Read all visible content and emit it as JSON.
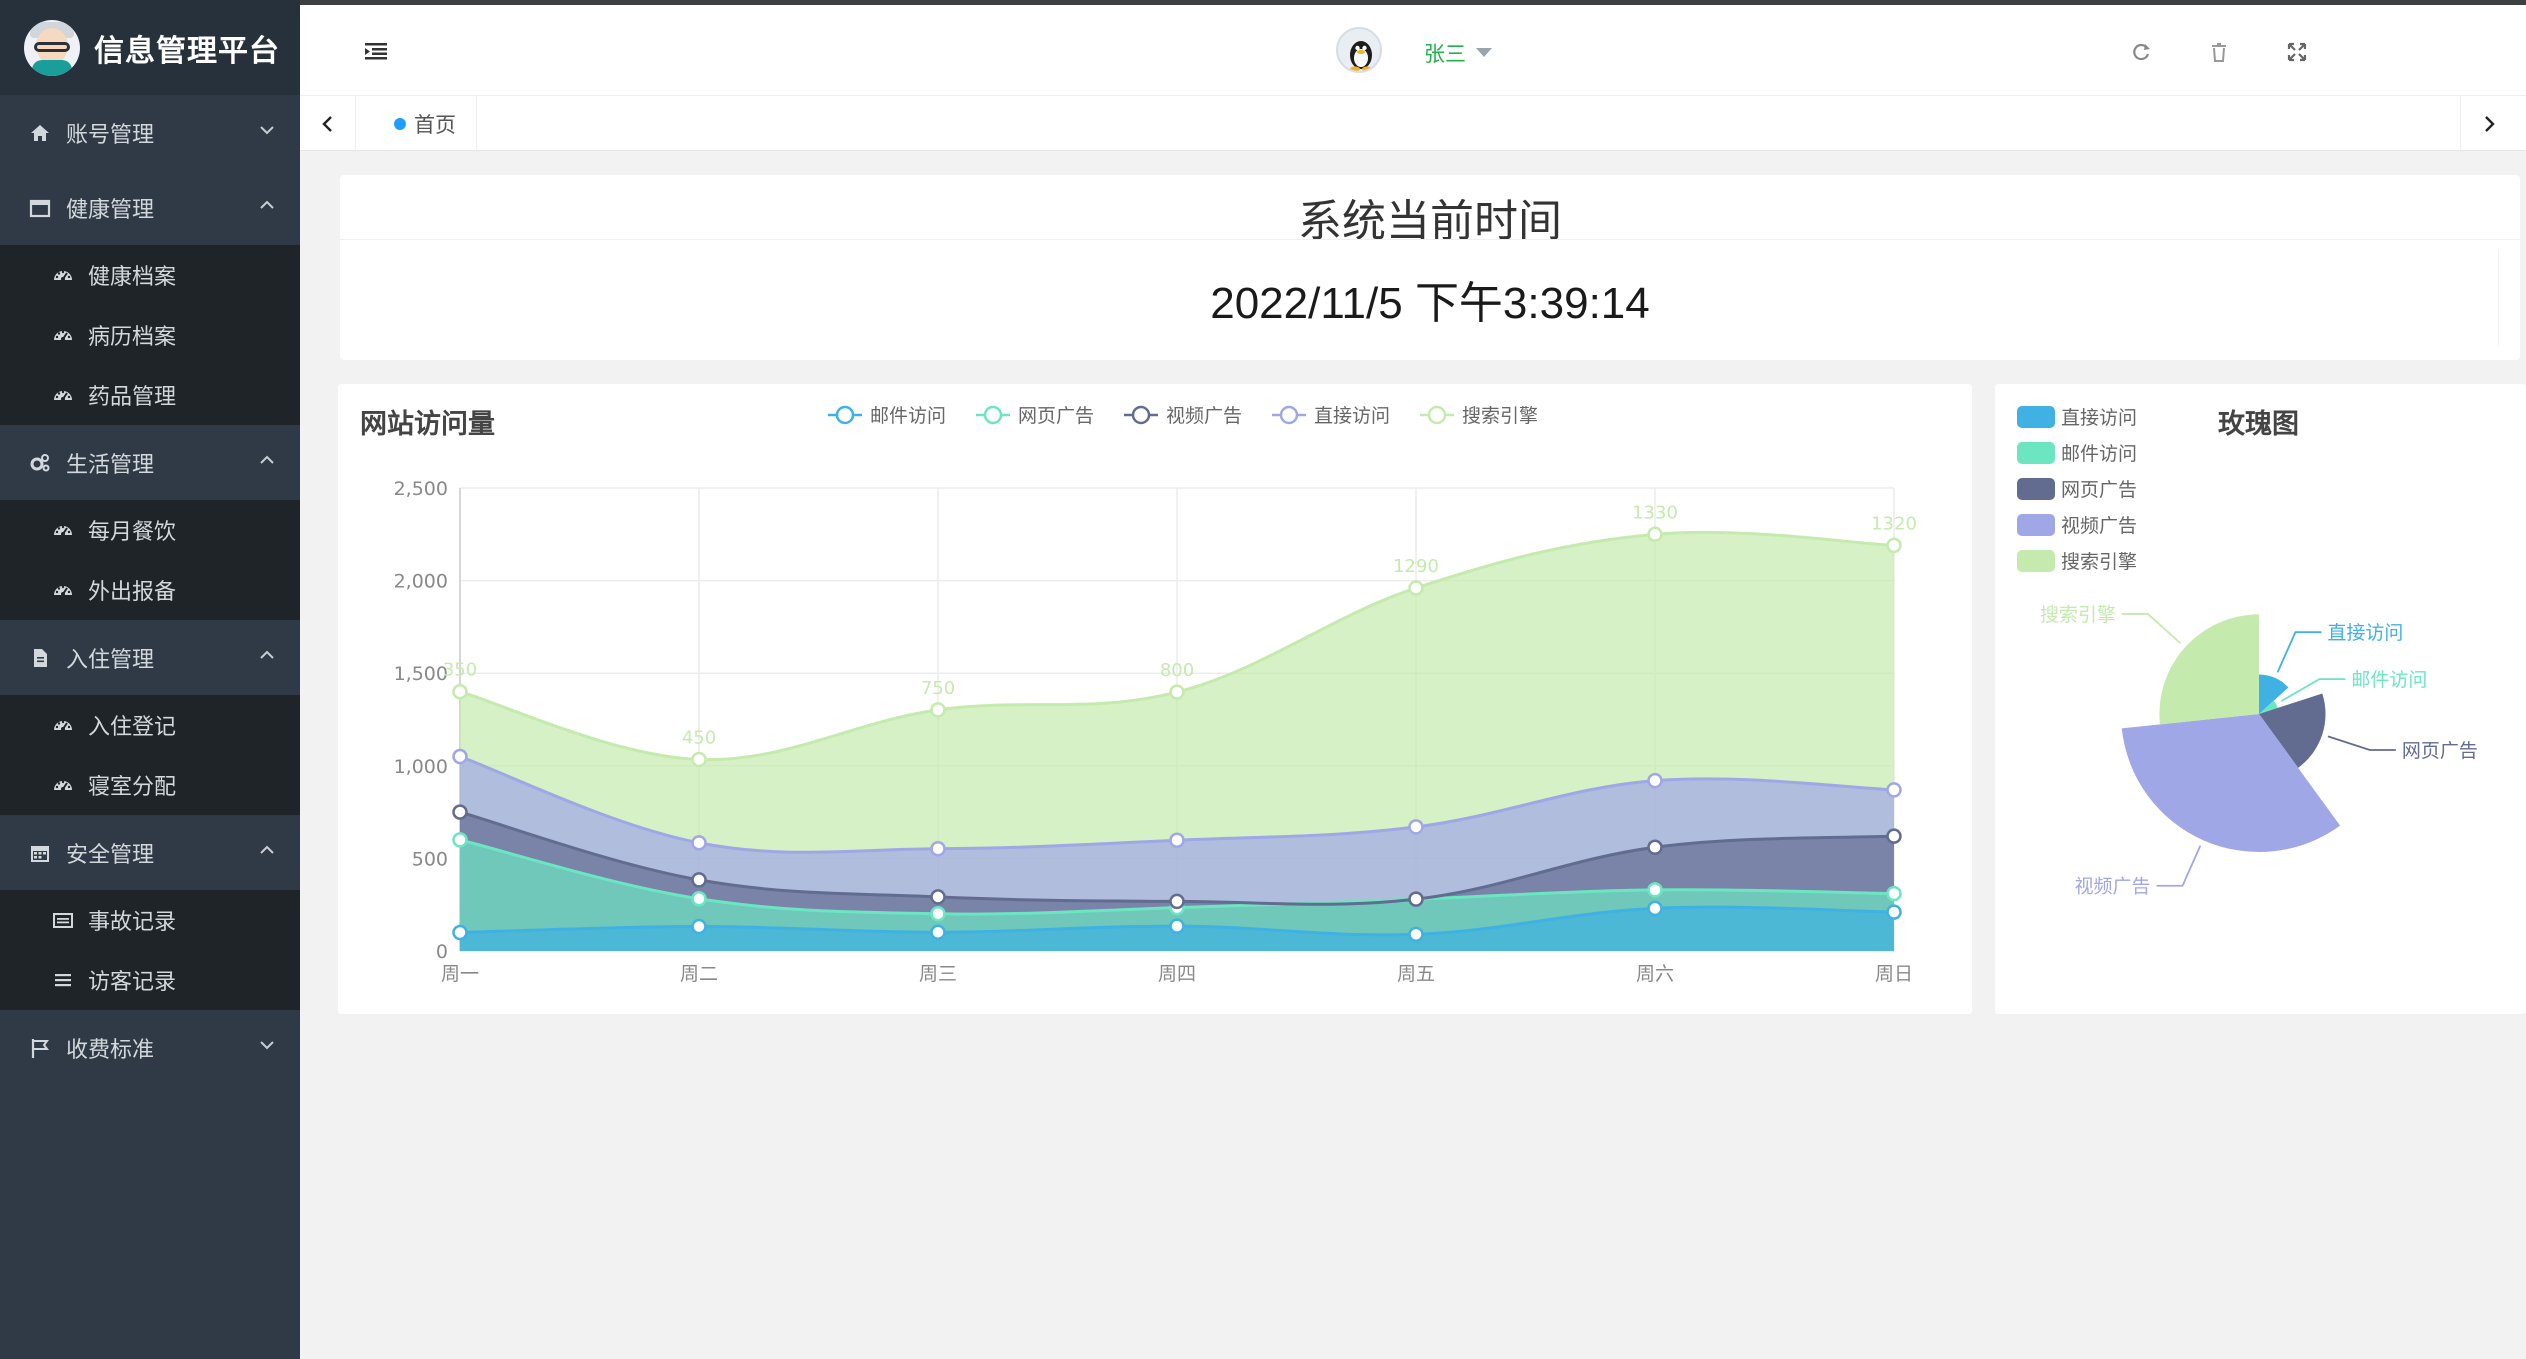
{
  "app": {
    "title": "信息管理平台"
  },
  "sidebar": {
    "menus": [
      {
        "label": "账号管理",
        "icon": "home-icon",
        "expanded": false,
        "children": []
      },
      {
        "label": "健康管理",
        "icon": "window-icon",
        "expanded": true,
        "children": [
          {
            "label": "健康档案",
            "icon": "dashboard-icon"
          },
          {
            "label": "病历档案",
            "icon": "dashboard-icon"
          },
          {
            "label": "药品管理",
            "icon": "dashboard-icon"
          }
        ]
      },
      {
        "label": "生活管理",
        "icon": "gears-icon",
        "expanded": true,
        "children": [
          {
            "label": "每月餐饮",
            "icon": "dashboard-icon"
          },
          {
            "label": "外出报备",
            "icon": "dashboard-icon"
          }
        ]
      },
      {
        "label": "入住管理",
        "icon": "file-icon",
        "expanded": true,
        "children": [
          {
            "label": "入住登记",
            "icon": "dashboard-icon"
          },
          {
            "label": "寝室分配",
            "icon": "dashboard-icon"
          }
        ]
      },
      {
        "label": "安全管理",
        "icon": "calendar-icon",
        "expanded": true,
        "children": [
          {
            "label": "事故记录",
            "icon": "card-icon"
          },
          {
            "label": "访客记录",
            "icon": "list-icon"
          }
        ]
      },
      {
        "label": "收费标准",
        "icon": "flag-icon",
        "expanded": false,
        "children": []
      }
    ]
  },
  "header": {
    "user_name": "张三",
    "icons": [
      "refresh-icon",
      "trash-icon",
      "fullscreen-icon"
    ]
  },
  "tabs": {
    "home_label": "首页"
  },
  "time_panel": {
    "title": "系统当前时间",
    "value": "2022/11/5 下午3:39:14"
  },
  "area_chart": {
    "title": "网站访问量"
  },
  "rose_chart": {
    "title": "玫瑰图"
  },
  "colors": {
    "blue": "#3fb1e3",
    "green": "#6be6c1",
    "navy": "#626c91",
    "purple": "#a0a7e6",
    "lime": "#c4ebad",
    "active_user": "#22b14c",
    "tab_dot": "#1e9fff"
  },
  "chart_data": [
    {
      "type": "area",
      "title": "网站访问量",
      "categories": [
        "周一",
        "周二",
        "周三",
        "周四",
        "周五",
        "周六",
        "周日"
      ],
      "ylim": [
        0,
        2500
      ],
      "yticks": [
        0,
        500,
        1000,
        1500,
        2000,
        2500
      ],
      "stacked": true,
      "legend_position": "top",
      "legend": [
        "邮件访问",
        "网页广告",
        "视频广告",
        "直接访问",
        "搜索引擎"
      ],
      "series": [
        {
          "name": "邮件访问",
          "color": "#3fb1e3",
          "values": [
            100,
            132,
            101,
            134,
            90,
            230,
            210
          ]
        },
        {
          "name": "网页广告",
          "color": "#6be6c1",
          "values": [
            500,
            150,
            100,
            100,
            190,
            100,
            100
          ]
        },
        {
          "name": "视频广告",
          "color": "#626c91",
          "values": [
            150,
            102,
            91,
            34,
            0,
            230,
            310
          ]
        },
        {
          "name": "直接访问",
          "color": "#a0a7e6",
          "values": [
            300,
            200,
            260,
            330,
            390,
            360,
            250
          ]
        },
        {
          "name": "搜索引擎",
          "color": "#c4ebad",
          "values": [
            350,
            450,
            750,
            800,
            1290,
            1330,
            1320
          ],
          "labels": true
        }
      ]
    },
    {
      "type": "pie",
      "subtype": "rose",
      "title": "玫瑰图",
      "legend_position": "top-left",
      "slices": [
        {
          "name": "直接访问",
          "color": "#3fb1e3",
          "value": 10
        },
        {
          "name": "邮件访问",
          "color": "#6be6c1",
          "value": 5
        },
        {
          "name": "网页广告",
          "color": "#626c91",
          "value": 15
        },
        {
          "name": "视频广告",
          "color": "#a0a7e6",
          "value": 25
        },
        {
          "name": "搜索引擎",
          "color": "#c4ebad",
          "value": 20
        }
      ],
      "note": "radius varies per slice"
    }
  ]
}
